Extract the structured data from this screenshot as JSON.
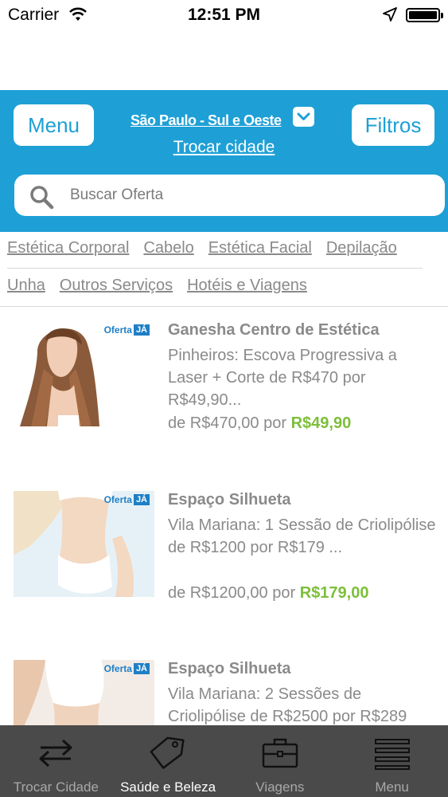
{
  "status_bar": {
    "carrier": "Carrier",
    "time": "12:51 PM"
  },
  "header": {
    "menu_label": "Menu",
    "filters_label": "Filtros",
    "city": "São Paulo - Sul e Oeste",
    "change_city": "Trocar cidade",
    "accent_color": "#1ea0d6"
  },
  "search": {
    "placeholder": "Buscar Oferta"
  },
  "categories": {
    "row1": [
      "Estética Corporal",
      "Cabelo",
      "Estética Facial",
      "Depilação"
    ],
    "row2": [
      "Unha",
      "Outros Serviços",
      "Hotéis e Viagens"
    ]
  },
  "offers": [
    {
      "badge": "Oferta",
      "badge_ja": "JÁ",
      "title": "Ganesha Centro de Estética",
      "description": "Pinheiros: Escova Progressiva a Laser + Corte de R$470 por R$49,90...",
      "price_prefix": "de R$470,00 por",
      "price": "R$49,90"
    },
    {
      "badge": "Oferta",
      "badge_ja": "JÁ",
      "title": "Espaço Silhueta",
      "description": "Vila Mariana: 1 Sessão de Criolipólise de R$1200 por R$179 ...",
      "price_prefix": "de R$1200,00 por",
      "price": "R$179,00"
    },
    {
      "badge": "Oferta",
      "badge_ja": "JÁ",
      "title": "Espaço Silhueta",
      "description": "Vila Mariana: 2 Sessões de Criolipólise de R$2500 por R$289",
      "price_prefix": "",
      "price": ""
    }
  ],
  "tab_bar": {
    "tabs": [
      {
        "label": "Trocar Cidade",
        "icon": "swap-arrows-icon",
        "active": false
      },
      {
        "label": "Saúde e Beleza",
        "icon": "tag-icon",
        "active": true
      },
      {
        "label": "Viagens",
        "icon": "briefcase-icon",
        "active": false
      },
      {
        "label": "Menu",
        "icon": "hamburger-menu-icon",
        "active": false
      }
    ]
  },
  "colors": {
    "price_green": "#7cbf3a",
    "tab_bar_bg": "#4a4a4a"
  }
}
